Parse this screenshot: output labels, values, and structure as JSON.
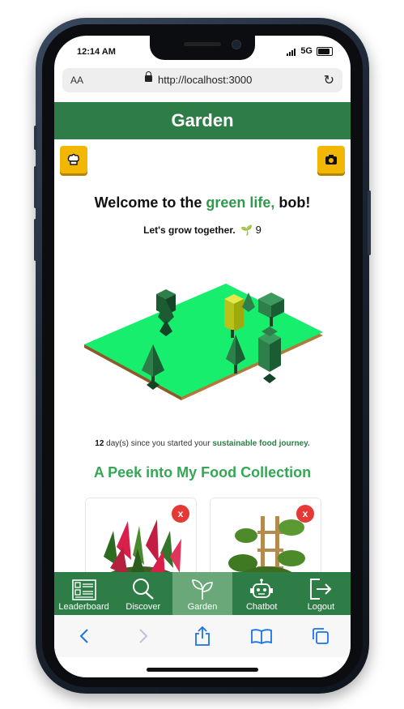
{
  "status": {
    "time": "12:14 AM",
    "network": "5G"
  },
  "browser": {
    "aa_label": "AA",
    "url": "http://localhost:3000"
  },
  "header": {
    "title": "Garden"
  },
  "welcome": {
    "prefix": "Welcome to the ",
    "highlight": "green life,",
    "name": " bob!"
  },
  "tagline": {
    "text": "Let's grow together.",
    "count": "9"
  },
  "journey": {
    "days": "12",
    "middle": " day(s) since you started your ",
    "link": "sustainable food journey."
  },
  "collection": {
    "title": "A Peek into My Food Collection",
    "remove_label": "x"
  },
  "nav": [
    {
      "label": "Leaderboard",
      "icon": "leaderboard-icon"
    },
    {
      "label": "Discover",
      "icon": "search-icon"
    },
    {
      "label": "Garden",
      "icon": "sprout-icon",
      "active": true
    },
    {
      "label": "Chatbot",
      "icon": "robot-icon"
    },
    {
      "label": "Logout",
      "icon": "logout-icon"
    }
  ],
  "colors": {
    "primary": "#2e7d46",
    "accent": "#f2b705",
    "danger": "#e53935",
    "heading_green": "#33a754"
  }
}
